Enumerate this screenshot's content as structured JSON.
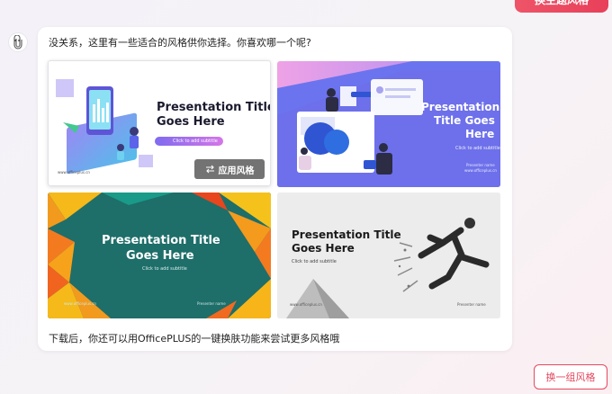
{
  "top_button": {
    "label": "换主题风格"
  },
  "message": {
    "intro": "没关系，这里有一些适合的风格供你选择。你喜欢哪一个呢?",
    "footer": "下载后，你还可以用OfficePLUS的一键换肤功能来尝试更多风格哦"
  },
  "templates": [
    {
      "title_line1": "Presentation Title",
      "title_line2": "Goes Here",
      "subtitle": "Click to add subtitle",
      "site": "www.officeplus.cn",
      "apply_label": "应用风格"
    },
    {
      "title_line1": "Presentation",
      "title_line2": "Title Goes",
      "title_line3": "Here",
      "subtitle": "Click to add subtitle",
      "presenter": "Presenter name",
      "site": "www.officeplus.cn"
    },
    {
      "title_line1": "Presentation Title",
      "title_line2": "Goes Here",
      "subtitle": "Click to add subtitle",
      "site": "www.officeplus.cn",
      "presenter": "Presenter name"
    },
    {
      "title_line1": "Presentation Title",
      "title_line2": "Goes Here",
      "subtitle": "Click to add subtitle",
      "site": "www.officeplus.cn",
      "presenter": "Presenter name"
    }
  ],
  "swap_button": {
    "label": "换一组风格"
  },
  "colors": {
    "accent": "#e5485f",
    "apply_bg": "#606060",
    "card3_bg": "#1e6e6a"
  }
}
